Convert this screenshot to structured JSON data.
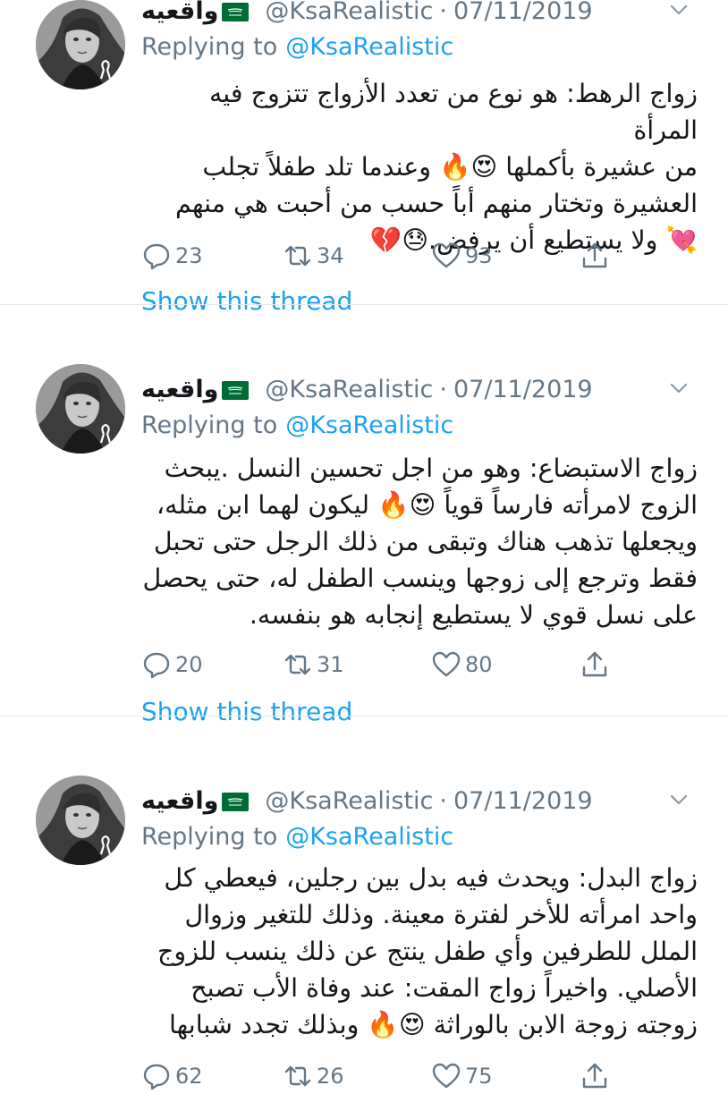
{
  "tweets": [
    {
      "name": "واقعيه",
      "handle": "@KsaRealistic",
      "separator": "·",
      "date": "07/11/2019",
      "replying_label": "Replying to",
      "replying_to": "@KsaRealistic",
      "lines": [
        "زواج الرهط: هو نوع من تعدد الأزواج تتزوج فيه المرأة",
        "من عشيرة بأكملها 😍🔥 وعندما تلد طفلاً تجلب",
        "العشيرة وتختار منهم أباً حسب من أحبت هي منهم",
        "💘 ولا يستطيع أن يرفض.😓💔"
      ],
      "reply_count": "23",
      "retweet_count": "34",
      "like_count": "93",
      "show_thread": "Show this thread"
    },
    {
      "name": "واقعيه",
      "handle": "@KsaRealistic",
      "separator": "·",
      "date": "07/11/2019",
      "replying_label": "Replying to",
      "replying_to": "@KsaRealistic",
      "lines": [
        "زواج الاستبضاع: وهو من اجل تحسين النسل .يبحث",
        "الزوج لامرأته فارساً قوياً 😍🔥 ليكون لهما ابن مثله،",
        "ويجعلها تذهب هناك وتبقى من ذلك الرجل حتى تحبل",
        "فقط وترجع إلى زوجها وينسب الطفل له، حتى يحصل",
        "على نسل قوي لا يستطيع إنجابه هو بنفسه."
      ],
      "reply_count": "20",
      "retweet_count": "31",
      "like_count": "80",
      "show_thread": "Show this thread"
    },
    {
      "name": "واقعيه",
      "handle": "@KsaRealistic",
      "separator": "·",
      "date": "07/11/2019",
      "replying_label": "Replying to",
      "replying_to": "@KsaRealistic",
      "lines": [
        "زواج البدل: ويحدث فيه بدل بين رجلين، فيعطي كل",
        "واحد امرأته للأخر لفترة معينة. وذلك للتغير وزوال",
        "الملل للطرفين وأي طفل ينتج عن ذلك ينسب للزوج",
        "الأصلي. واخيراً زواج المقت: عند وفاة الأب تصبح",
        "زوجته زوجة الابن بالوراثة 😍🔥 وبذلك تجدد شبابها"
      ],
      "reply_count": "62",
      "retweet_count": "26",
      "like_count": "75",
      "show_thread": ""
    }
  ],
  "icons": {
    "reply": "reply-bubble-icon",
    "retweet": "retweet-icon",
    "like": "heart-icon",
    "share": "share-icon",
    "more": "chevron-down-icon",
    "flag": "saudi-flag-icon"
  },
  "colors": {
    "link": "#1da1f2",
    "secondary": "#657786",
    "text": "#14171a",
    "divider": "#e1e8ed",
    "flag_green": "#006c35"
  }
}
